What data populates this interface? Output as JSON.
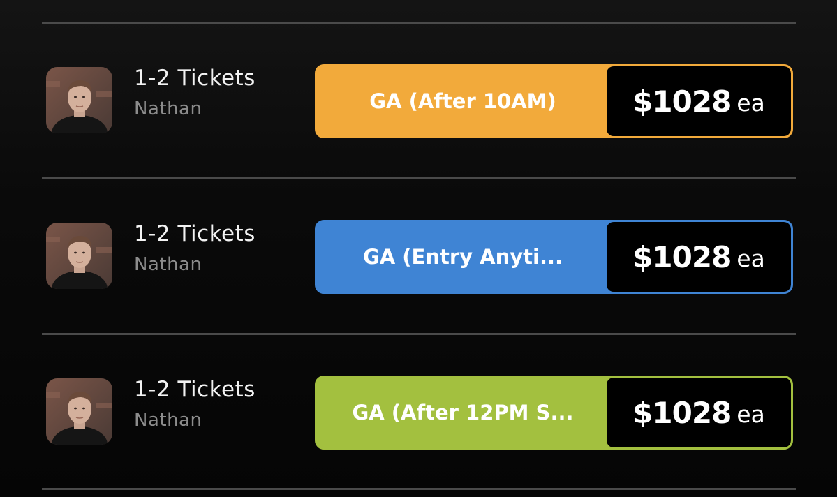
{
  "listings": [
    {
      "quantity": "1-2 Tickets",
      "seller": "Nathan",
      "ticket_type": "GA (After 10AM)",
      "price": "$1028",
      "price_unit": "ea",
      "color": "#f2aa3b"
    },
    {
      "quantity": "1-2 Tickets",
      "seller": "Nathan",
      "ticket_type": "GA (Entry Anyti...",
      "price": "$1028",
      "price_unit": "ea",
      "color": "#3f84d4"
    },
    {
      "quantity": "1-2 Tickets",
      "seller": "Nathan",
      "ticket_type": "GA (After 12PM S...",
      "price": "$1028",
      "price_unit": "ea",
      "color": "#a3c03f"
    }
  ]
}
